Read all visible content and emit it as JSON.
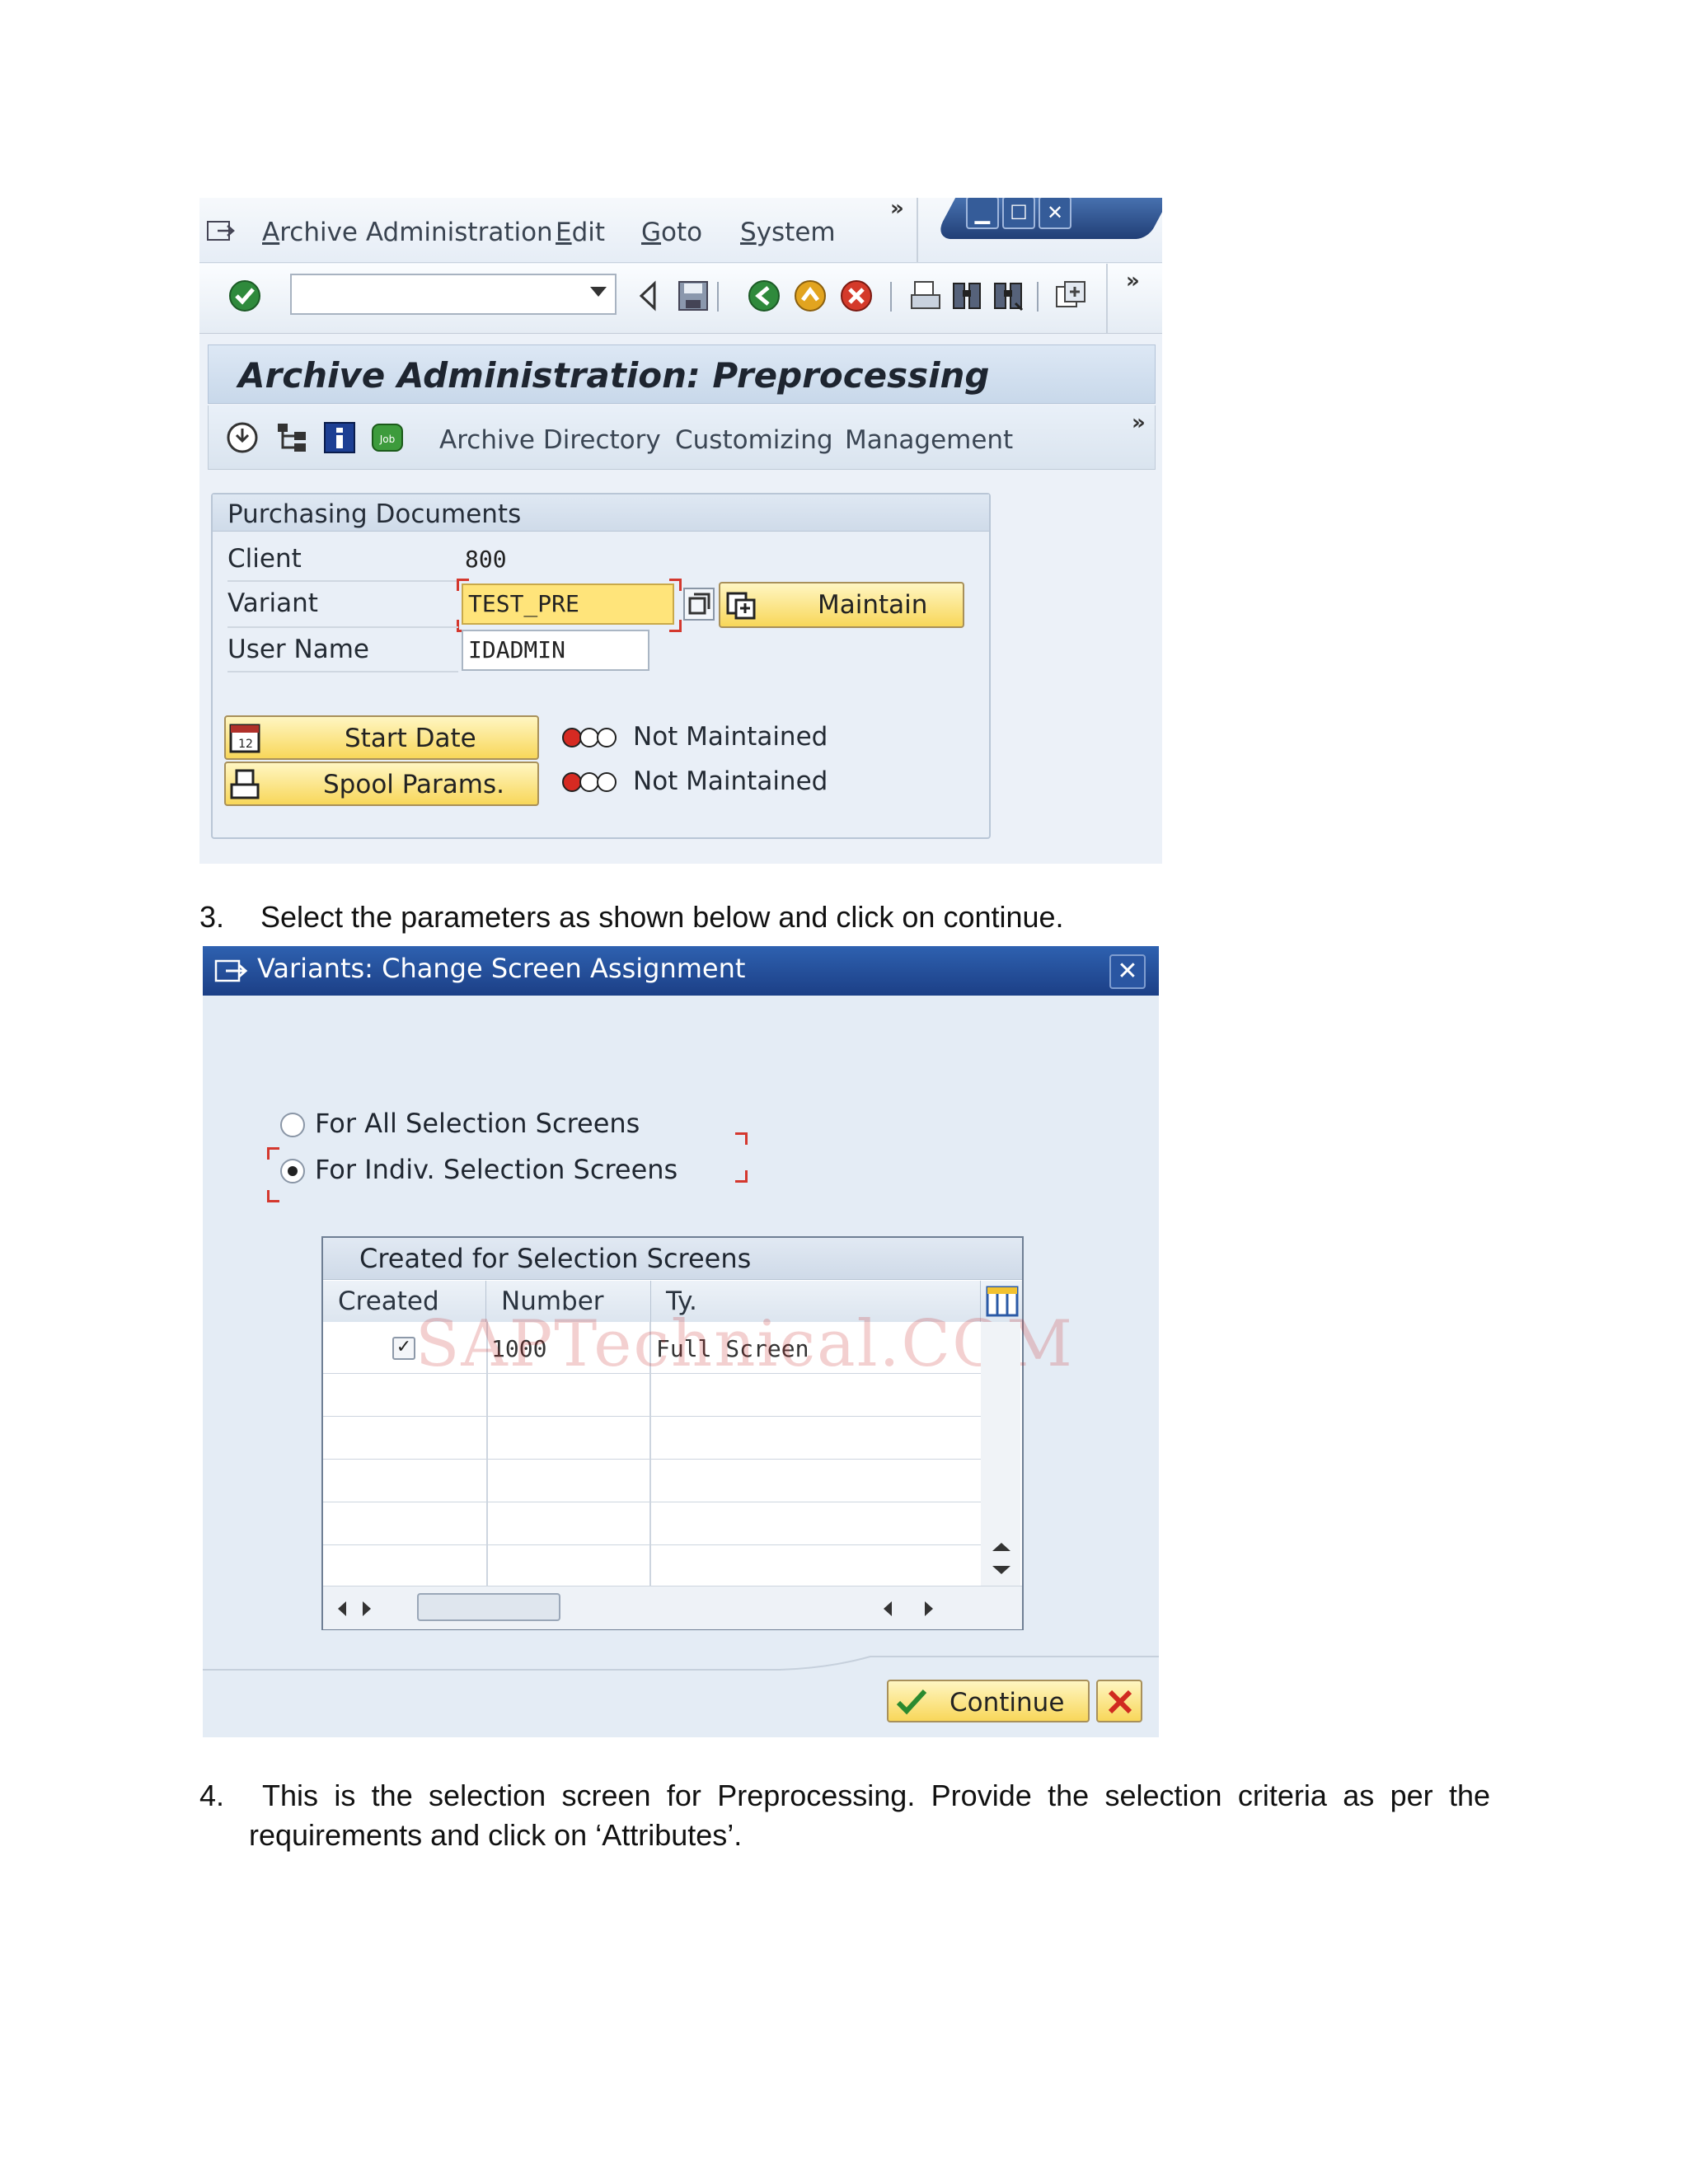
{
  "screen1": {
    "menu": {
      "items": [
        "Archive Administration",
        "Edit",
        "Goto",
        "System"
      ],
      "overflow_glyph": "»"
    },
    "window_controls": [
      "minimize-icon",
      "maximize-icon",
      "close-icon"
    ],
    "command_field": {
      "value": ""
    },
    "toolbar_icons": [
      "enter-icon",
      "back-arrow-icon",
      "save-icon",
      "back-icon",
      "exit-icon",
      "cancel-icon",
      "print-icon",
      "find-icon",
      "find-next-icon",
      "new-session-icon"
    ],
    "title": "Archive Administration: Preprocessing",
    "app_toolbar": {
      "icons": [
        "execute-icon",
        "structure-icon",
        "info-icon",
        "job-icon"
      ],
      "links": [
        "Archive Directory",
        "Customizing",
        "Management"
      ],
      "overflow_glyph": "»"
    },
    "group": {
      "title": "Purchasing Documents",
      "client_label": "Client",
      "client_value": "800",
      "variant_label": "Variant",
      "variant_value": "TEST_PRE",
      "maintain_label": "Maintain",
      "username_label": "User Name",
      "username_value": "IDADMIN",
      "start_date_label": "Start Date",
      "spool_label": "Spool Params.",
      "start_date_status": "Not Maintained",
      "spool_status": "Not Maintained",
      "status_color": "#d62a22"
    }
  },
  "step3": {
    "number": "3.",
    "text": "Select the parameters as shown below and click on continue."
  },
  "screen2": {
    "title": "Variants: Change Screen Assignment",
    "close_glyph": "✕",
    "radio_all": {
      "label": "For All Selection Screens",
      "selected": false
    },
    "radio_indiv": {
      "label": "For Indiv. Selection Screens",
      "selected": true
    },
    "table": {
      "title": "Created for Selection Screens",
      "columns": [
        "Created",
        "Number",
        "Ty."
      ],
      "rows": [
        {
          "created": true,
          "number": "1000",
          "type": "Full Screen"
        }
      ]
    },
    "watermark": "SAPTechnical.COM",
    "continue_label": "Continue"
  },
  "step4": {
    "number": "4.",
    "line1": "This is the selection screen for Preprocessing. Provide the selection criteria as per the",
    "line2": "requirements and click on ‘Attributes’."
  }
}
